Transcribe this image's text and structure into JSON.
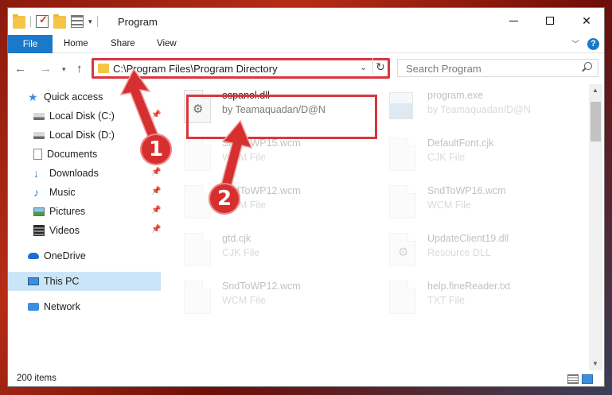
{
  "window": {
    "title": "Program",
    "help_label": "?"
  },
  "ribbon": {
    "file_label": "File",
    "home_label": "Home",
    "share_label": "Share",
    "view_label": "View"
  },
  "address": {
    "path": "C:\\Program Files\\Program Directory"
  },
  "search": {
    "placeholder": "Search Program"
  },
  "sidebar": {
    "items": [
      {
        "label": "Quick access",
        "icon": "star-icon"
      },
      {
        "label": "Local Disk (C:)",
        "icon": "drive-icon",
        "pinned": true
      },
      {
        "label": "Local Disk (D:)",
        "icon": "drive-icon"
      },
      {
        "label": "Documents",
        "icon": "documents-icon",
        "pinned": true
      },
      {
        "label": "Downloads",
        "icon": "downloads-icon",
        "pinned": true
      },
      {
        "label": "Music",
        "icon": "music-icon",
        "pinned": true
      },
      {
        "label": "Pictures",
        "icon": "pictures-icon",
        "pinned": true
      },
      {
        "label": "Videos",
        "icon": "videos-icon",
        "pinned": true
      },
      {
        "label": "OneDrive",
        "icon": "onedrive-icon"
      },
      {
        "label": "This PC",
        "icon": "pc-icon",
        "selected": true
      },
      {
        "label": "Network",
        "icon": "network-icon"
      }
    ]
  },
  "files": [
    {
      "name": "espanol.dll",
      "type": "by Teamaquadan/D@N"
    },
    {
      "name": "program.exe",
      "type": "by Teamaquadan/D@N"
    },
    {
      "name": "SndToWP15.wcm",
      "type": "WCM File"
    },
    {
      "name": "DefaultFont.cjk",
      "type": "CJK File"
    },
    {
      "name": "SndToWP12.wcm",
      "type": "WCM File"
    },
    {
      "name": "SndToWP16.wcm",
      "type": "WCM File"
    },
    {
      "name": "gtd.cjk",
      "type": "CJK File"
    },
    {
      "name": "UpdateClient19.dll",
      "type": "Resource DLL"
    },
    {
      "name": "SndToWP12.wcm",
      "type": "WCM File"
    },
    {
      "name": "help.fineReader.txt",
      "type": "TXT File"
    }
  ],
  "status": {
    "item_count": "200 items"
  },
  "callouts": {
    "one": "1",
    "two": "2"
  },
  "colors": {
    "accent": "#1979ca",
    "highlight_red": "#d9363e",
    "selected_bg": "#cce4f7"
  }
}
